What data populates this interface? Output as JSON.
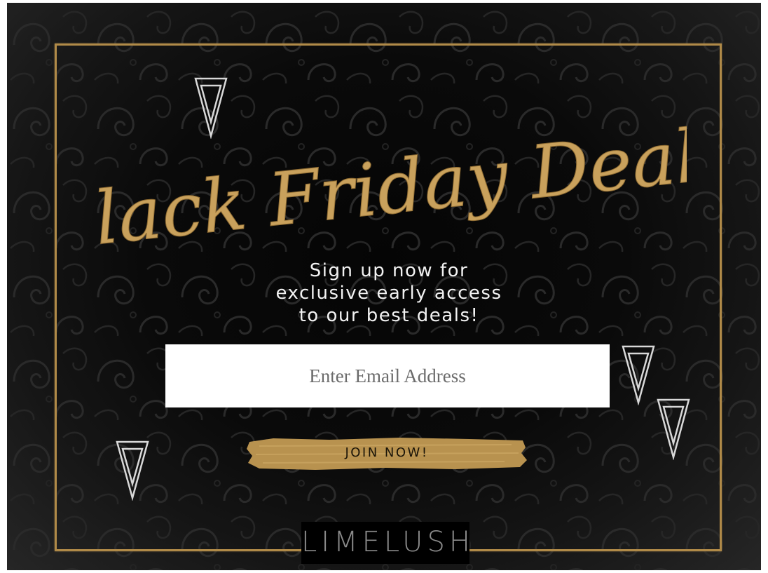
{
  "popup": {
    "headline": "Black Friday Deals",
    "subtext_lines": [
      "Sign up now for",
      "exclusive early access",
      "to our best deals!"
    ],
    "email_placeholder": "Enter Email Address",
    "join_label": "JOIN NOW!",
    "brand": "LIMELUSH"
  },
  "colors": {
    "gold": "#b08a48",
    "background": "#0a0a0a",
    "text": "#f2f2f2"
  },
  "icons": [
    "triangle-icon"
  ]
}
